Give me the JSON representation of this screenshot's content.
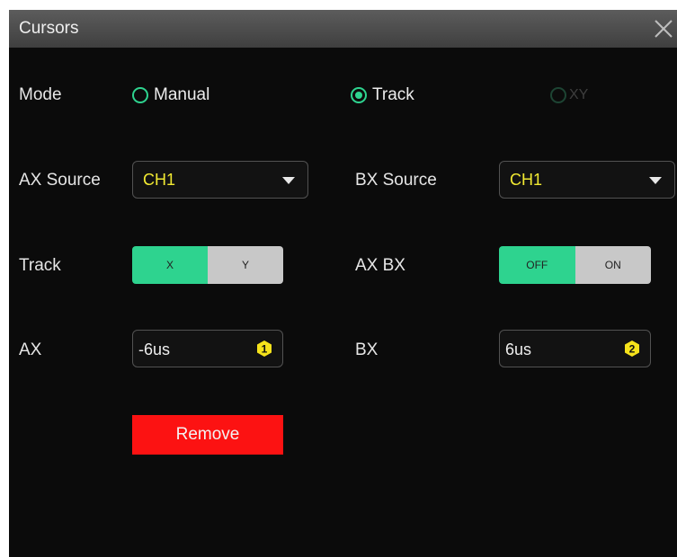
{
  "dialog": {
    "title": "Cursors",
    "close_icon": "close-icon"
  },
  "mode": {
    "label": "Mode",
    "options": [
      "Manual",
      "Track",
      "XY"
    ],
    "selected": "Track",
    "disabled": [
      "XY"
    ]
  },
  "ax_source": {
    "label": "AX Source",
    "value": "CH1"
  },
  "bx_source": {
    "label": "BX Source",
    "value": "CH1"
  },
  "track": {
    "label": "Track",
    "options": [
      "X",
      "Y"
    ],
    "selected": "X"
  },
  "ax_bx": {
    "label": "AX BX",
    "options": [
      "OFF",
      "ON"
    ],
    "selected": "OFF"
  },
  "ax": {
    "label": "AX",
    "value": "-6us",
    "badge": "1"
  },
  "bx": {
    "label": "BX",
    "value": "6us",
    "badge": "2"
  },
  "remove_label": "Remove",
  "colors": {
    "accent": "#2ed38f",
    "source_value": "#f2ea32",
    "remove": "#fc1212",
    "badge": "#f5e21b"
  }
}
